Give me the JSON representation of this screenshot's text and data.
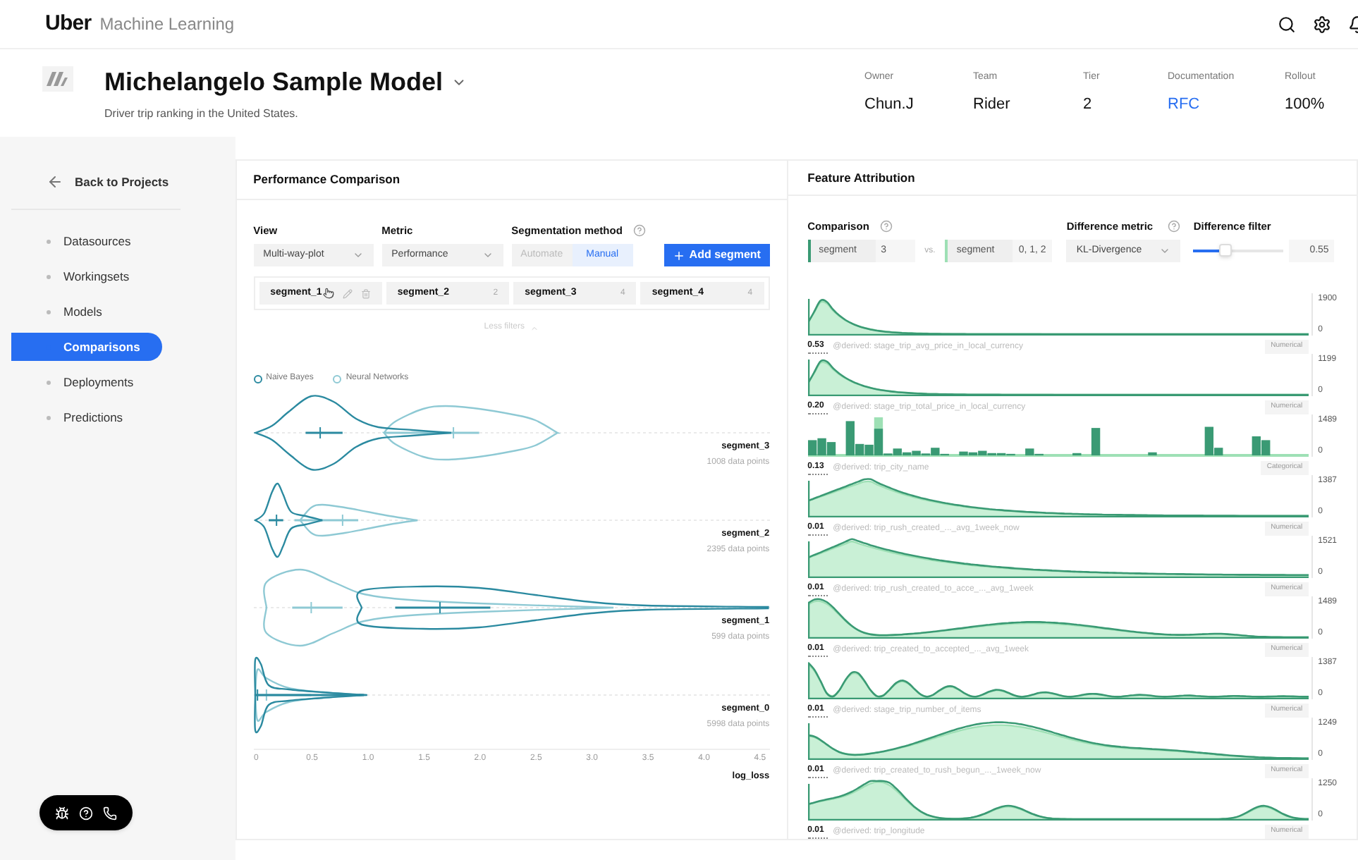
{
  "topbar": {
    "brand": "Uber",
    "product": "Machine Learning"
  },
  "header": {
    "title": "Michelangelo Sample Model",
    "subtitle": "Driver trip ranking in the United States.",
    "meta": [
      {
        "label": "Owner",
        "value": "Chun.J",
        "kind": "text"
      },
      {
        "label": "Team",
        "value": "Rider",
        "kind": "text"
      },
      {
        "label": "Tier",
        "value": "2",
        "kind": "text"
      },
      {
        "label": "Documentation",
        "value": "RFC",
        "kind": "link"
      },
      {
        "label": "Rollout",
        "value": "100%",
        "kind": "text"
      }
    ]
  },
  "sidebar": {
    "back": "Back to Projects",
    "items": [
      {
        "label": "Datasources",
        "selected": false
      },
      {
        "label": "Workingsets",
        "selected": false
      },
      {
        "label": "Models",
        "selected": false
      },
      {
        "label": "Comparisons",
        "selected": true
      },
      {
        "label": "Deployments",
        "selected": false
      },
      {
        "label": "Predictions",
        "selected": false
      }
    ]
  },
  "performance": {
    "title": "Performance Comparison",
    "view": {
      "label": "View",
      "value": "Multi-way-plot"
    },
    "metric": {
      "label": "Metric",
      "value": "Performance"
    },
    "segmentation": {
      "label": "Segmentation method",
      "options": [
        {
          "label": "Automate",
          "selected": false
        },
        {
          "label": "Manual",
          "selected": true
        }
      ]
    },
    "add_button": "Add segment",
    "segments": [
      {
        "kind": "editable",
        "name": "segment_1"
      },
      {
        "kind": "count",
        "name": "segment_2",
        "count": "2"
      },
      {
        "kind": "count",
        "name": "segment_3",
        "count": "4"
      },
      {
        "kind": "count",
        "name": "segment_4",
        "count": "4"
      }
    ],
    "less_filters": "Less filters",
    "legend": [
      {
        "label": "Naive Bayes",
        "color": "#2b8aa0"
      },
      {
        "label": "Neural Networks",
        "color": "#8ec9d4"
      }
    ],
    "violins": [
      {
        "segment": "segment_3",
        "points": "1008 data points"
      },
      {
        "segment": "segment_2",
        "points": "2395 data points"
      },
      {
        "segment": "segment_1",
        "points": "599 data points"
      },
      {
        "segment": "segment_0",
        "points": "5998 data points"
      }
    ],
    "axis": {
      "ticks": [
        "0",
        "0.5",
        "1.0",
        "1.5",
        "2.0",
        "2.5",
        "3.0",
        "3.5",
        "4.0",
        "4.5"
      ],
      "label": "log_loss"
    }
  },
  "attribution": {
    "title": "Feature Attribution",
    "comparison": {
      "label": "Comparison",
      "left": {
        "label": "segment",
        "value": "3",
        "color": "#3a9a74"
      },
      "vs": "vs.",
      "right": {
        "label": "segment",
        "value": "0, 1, 2",
        "color": "#9ee0b5"
      }
    },
    "difference_metric": {
      "label": "Difference metric",
      "value": "KL-Divergence"
    },
    "difference_filter": {
      "label": "Difference filter",
      "level": 0.35,
      "value": "0.55"
    },
    "features": [
      {
        "score": "0.53",
        "name": "@derived: stage_trip_avg_price_in_local_currency",
        "type": "Numerical",
        "kind": "curve",
        "max": "1900",
        "min": "0"
      },
      {
        "score": "0.20",
        "name": "@derived: stage_trip_total_price_in_local_currency",
        "type": "Numerical",
        "kind": "curve",
        "max": "1199",
        "min": "0"
      },
      {
        "score": "0.13",
        "name": "@derived: trip_city_name",
        "type": "Categorical",
        "kind": "bars",
        "max": "1489",
        "min": "0"
      },
      {
        "score": "0.01",
        "name": "@derived: trip_rush_created_..._avg_1week_now",
        "type": "Numerical",
        "kind": "curve",
        "max": "1387",
        "min": "0"
      },
      {
        "score": "0.01",
        "name": "@derived: trip_rush_created_to_acce_..._avg_1week",
        "type": "Numerical",
        "kind": "curve",
        "max": "1521",
        "min": "0"
      },
      {
        "score": "0.01",
        "name": "@derived: trip_created_to_accepted_..._avg_1week",
        "type": "Numerical",
        "kind": "curve",
        "max": "1489",
        "min": "0"
      },
      {
        "score": "0.01",
        "name": "@derived: stage_trip_number_of_items",
        "type": "Numerical",
        "kind": "curve",
        "max": "1387",
        "min": "0"
      },
      {
        "score": "0.01",
        "name": "@derived: trip_created_to_rush_begun_..._1week_now",
        "type": "Numerical",
        "kind": "curve",
        "max": "1249",
        "min": "0"
      },
      {
        "score": "0.01",
        "name": "@derived: trip_longitude",
        "type": "Numerical",
        "kind": "curve",
        "max": "1250",
        "min": "0"
      }
    ]
  }
}
